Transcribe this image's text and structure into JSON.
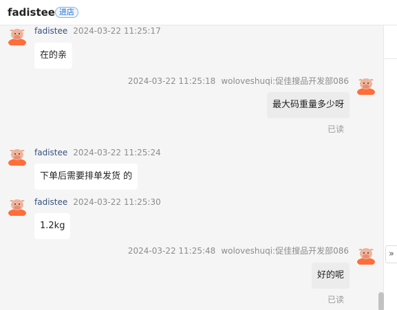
{
  "header": {
    "title": "fadistee",
    "shop_label": "进店"
  },
  "expand_glyph": "»",
  "messages": [
    {
      "direction": "in",
      "sender": "fadistee",
      "time": "2024-03-22 11:25:17",
      "text": "在的亲"
    },
    {
      "direction": "out",
      "time": "2024-03-22 11:25:18",
      "sender": "woloveshuqi:促佳搜品开发部086",
      "text": "最大码重量多少呀",
      "status": "已读"
    },
    {
      "direction": "in",
      "sender": "fadistee",
      "time": "2024-03-22 11:25:24",
      "text": "下单后需要排单发货 的"
    },
    {
      "direction": "in",
      "sender": "fadistee",
      "time": "2024-03-22 11:25:30",
      "text": "1.2kg"
    },
    {
      "direction": "out",
      "time": "2024-03-22 11:25:48",
      "sender": "woloveshuqi:促佳搜品开发部086",
      "text": "好的呢",
      "status": "已读"
    }
  ]
}
